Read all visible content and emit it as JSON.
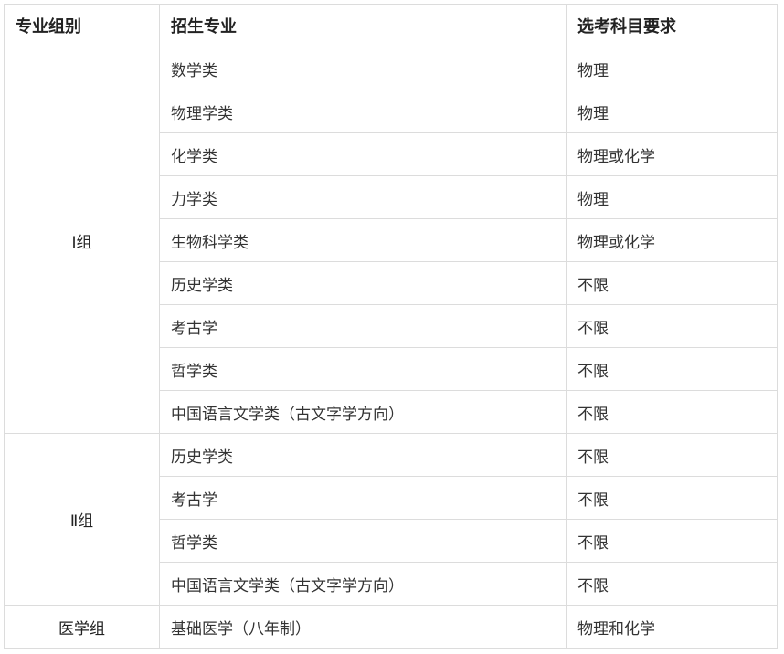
{
  "headers": [
    "专业组别",
    "招生专业",
    "选考科目要求"
  ],
  "groups": [
    {
      "name": "Ⅰ组",
      "rows": [
        {
          "major": "数学类",
          "req": "物理"
        },
        {
          "major": "物理学类",
          "req": "物理"
        },
        {
          "major": "化学类",
          "req": "物理或化学"
        },
        {
          "major": "力学类",
          "req": "物理"
        },
        {
          "major": "生物科学类",
          "req": "物理或化学"
        },
        {
          "major": "历史学类",
          "req": "不限"
        },
        {
          "major": "考古学",
          "req": "不限"
        },
        {
          "major": "哲学类",
          "req": "不限"
        },
        {
          "major": "中国语言文学类（古文字学方向）",
          "req": "不限"
        }
      ]
    },
    {
      "name": "Ⅱ组",
      "rows": [
        {
          "major": "历史学类",
          "req": "不限"
        },
        {
          "major": "考古学",
          "req": "不限"
        },
        {
          "major": "哲学类",
          "req": "不限"
        },
        {
          "major": "中国语言文学类（古文字学方向）",
          "req": "不限"
        }
      ]
    },
    {
      "name": "医学组",
      "rows": [
        {
          "major": "基础医学（八年制）",
          "req": "物理和化学"
        }
      ]
    }
  ]
}
